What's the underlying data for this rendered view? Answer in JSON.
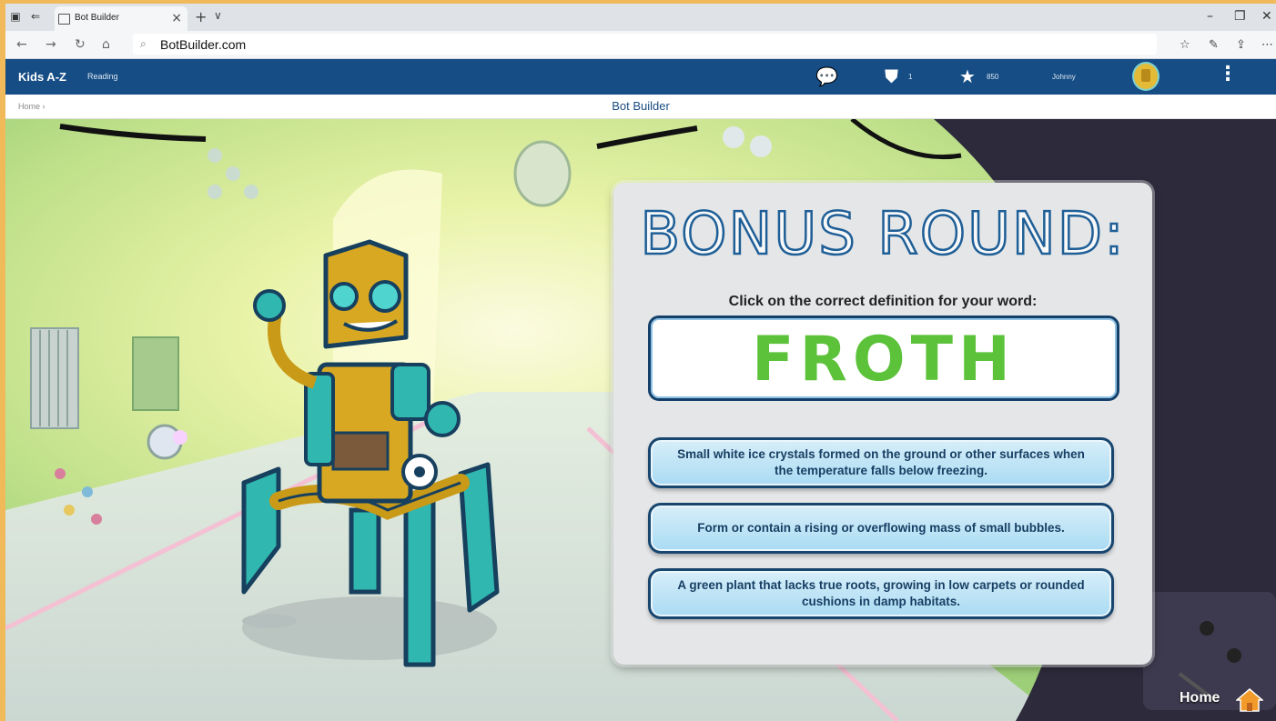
{
  "browser": {
    "tab_title": "Bot Builder",
    "tab_close": "×",
    "new_tab": "+",
    "tab_menu": "∨",
    "url": "BotBuilder.com",
    "win_minimize": "–",
    "win_restore": "❐",
    "win_close": "✕"
  },
  "site": {
    "logo": "Kids A-Z",
    "section": "Reading",
    "stars_count": "850",
    "username": "Johnny",
    "shield_count": "1"
  },
  "breadcrumb": {
    "home": "Home ›"
  },
  "page_title": "Bot Builder",
  "game": {
    "heading": "BONUS ROUND:",
    "instruction": "Click on the correct definition for your word:",
    "word": "FROTH",
    "options": [
      "Small white ice crystals formed on the ground or other surfaces when the temperature falls below freezing.",
      "Form or contain a rising or overflowing mass of small bubbles.",
      "A green plant that lacks true roots, growing in low carpets or rounded cushions in damp habitats."
    ],
    "home_label": "Home"
  },
  "colors": {
    "header_blue": "#154d84",
    "word_green": "#5cc23a",
    "option_fill": "#a9dbf3",
    "outer_orange": "#f0b95a"
  },
  "icons": {
    "chat": "speech-bubble-icon",
    "shield": "shield-icon",
    "star": "star-icon",
    "home": "house-icon"
  }
}
